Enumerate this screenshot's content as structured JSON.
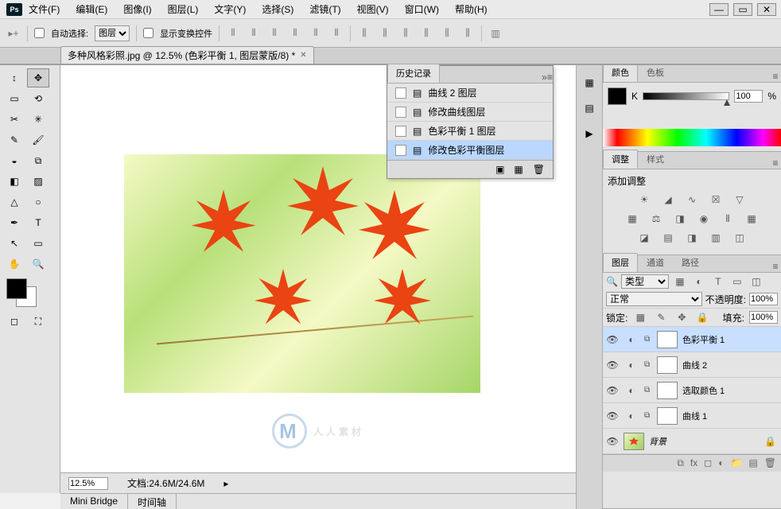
{
  "app": {
    "name": "Ps"
  },
  "menu": [
    "文件(F)",
    "编辑(E)",
    "图像(I)",
    "图层(L)",
    "文字(Y)",
    "选择(S)",
    "滤镜(T)",
    "视图(V)",
    "窗口(W)",
    "帮助(H)"
  ],
  "options": {
    "auto_select": "自动选择:",
    "auto_select_target": "图层",
    "show_transform": "显示变换控件"
  },
  "tab": {
    "title": "多种风格彩照.jpg @ 12.5% (色彩平衡 1, 图层蒙版/8) *"
  },
  "status": {
    "zoom": "12.5%",
    "doc": "文档:24.6M/24.6M"
  },
  "bottom_tabs": [
    "Mini Bridge",
    "时间轴"
  ],
  "history": {
    "title": "历史记录",
    "items": [
      "曲线 2 图层",
      "修改曲线图层",
      "色彩平衡 1 图层",
      "修改色彩平衡图层"
    ],
    "selected_index": 3
  },
  "color_panel": {
    "tabs": [
      "颜色",
      "色板"
    ],
    "channel": "K",
    "value": "100",
    "percent": "%"
  },
  "adjust_panel": {
    "tabs": [
      "调整",
      "样式"
    ],
    "heading": "添加调整"
  },
  "layers_panel": {
    "tabs": [
      "图层",
      "通道",
      "路径"
    ],
    "kind": "类型",
    "blend_mode": "正常",
    "opacity_label": "不透明度:",
    "opacity": "100%",
    "lock_label": "锁定:",
    "fill_label": "填充:",
    "fill": "100%",
    "search_icon": "🔍",
    "layers": [
      {
        "name": "色彩平衡 1",
        "selected": true,
        "adj": true
      },
      {
        "name": "曲线 2",
        "adj": true
      },
      {
        "name": "选取颜色 1",
        "adj": true
      },
      {
        "name": "曲线 1",
        "adj": true
      },
      {
        "name": "背景",
        "bg": true
      }
    ]
  },
  "watermark": "人人素材"
}
